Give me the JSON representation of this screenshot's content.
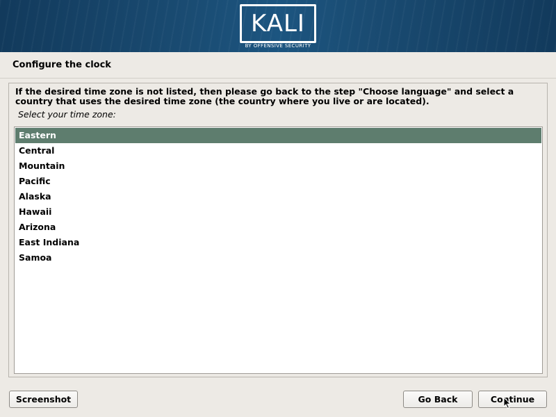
{
  "banner": {
    "logo_text": "KALI",
    "logo_subtext": "BY OFFENSIVE SECURITY"
  },
  "page": {
    "title": "Configure the clock",
    "description": "If the desired time zone is not listed, then please go back to the step \"Choose language\" and select a country that uses the desired time zone (the country where you live or are located).",
    "prompt": "Select your time zone:"
  },
  "timezones": {
    "selected": "Eastern",
    "items": [
      "Eastern",
      "Central",
      "Mountain",
      "Pacific",
      "Alaska",
      "Hawaii",
      "Arizona",
      "East Indiana",
      "Samoa"
    ]
  },
  "buttons": {
    "screenshot": "Screenshot",
    "go_back": "Go Back",
    "continue": "Continue"
  },
  "colors": {
    "selection": "#5e7d6e",
    "banner": "#1a4c73"
  }
}
